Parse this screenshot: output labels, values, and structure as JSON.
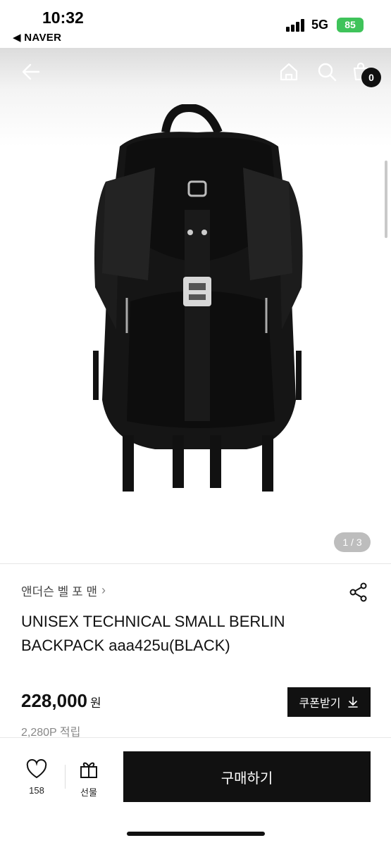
{
  "status_bar": {
    "time": "10:32",
    "back_app": "◀ NAVER",
    "network": "5G",
    "battery": "85"
  },
  "nav": {
    "cart_count": "0",
    "icons": [
      "back-arrow-icon",
      "home-icon",
      "search-icon",
      "cart-icon"
    ]
  },
  "gallery": {
    "page_indicator": "1 / 3"
  },
  "product": {
    "brand": "앤더슨 벨 포 맨",
    "title": "UNISEX TECHNICAL SMALL BERLIN BACKPACK aaa425u(BLACK)",
    "price": "228,000",
    "price_unit": "원",
    "coupon_label": "쿠폰받기",
    "points": "2,280P 적립"
  },
  "bottom_bar": {
    "like_count": "158",
    "gift_label": "선물",
    "buy_label": "구매하기"
  }
}
